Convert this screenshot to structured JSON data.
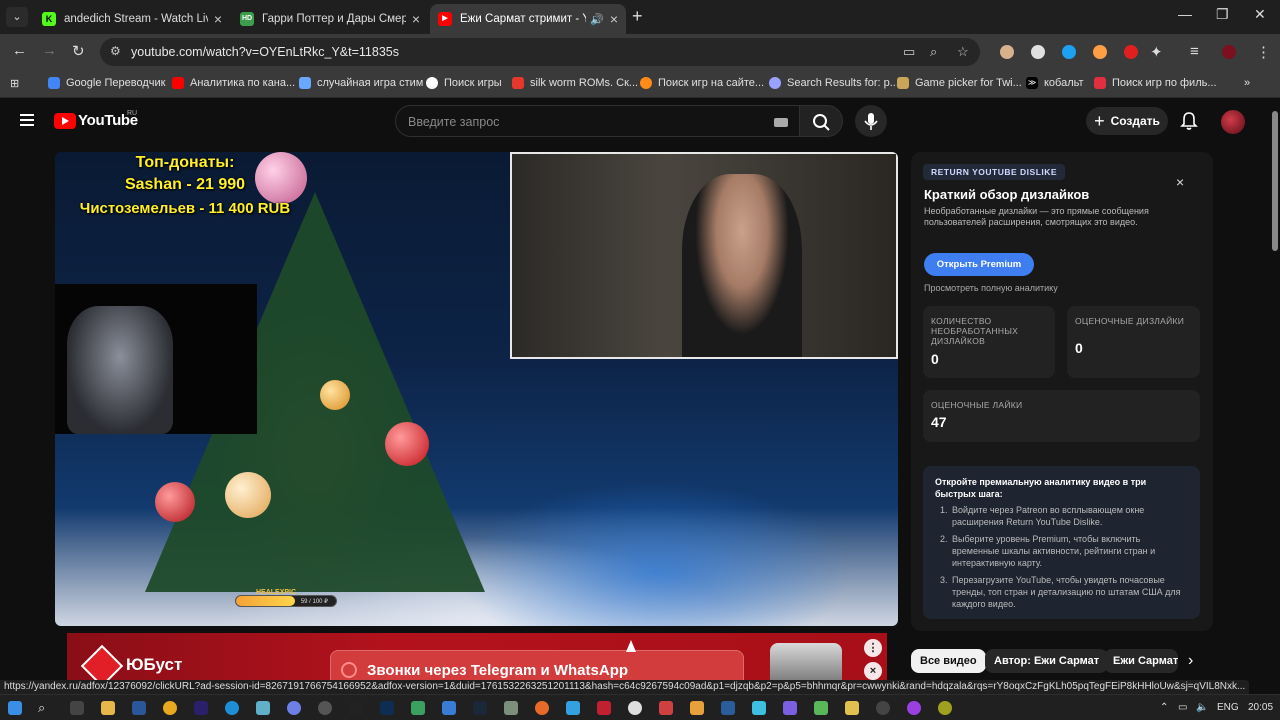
{
  "browser": {
    "tabs": [
      {
        "title": "andedich Stream - Watch Live o",
        "favicon_color": "#53fc18",
        "favicon_letter": "K",
        "active": false
      },
      {
        "title": "Гарри Поттер и Дары Смерти",
        "favicon_color": "#3c9d4a",
        "favicon_letter": "HD",
        "active": false
      },
      {
        "title": "Ежи Сармат стримит - You",
        "favicon_color": "#ff0000",
        "favicon_letter": "▶",
        "active": true
      }
    ],
    "url": "youtube.com/watch?v=OYEnLtRkc_Y&t=11835s",
    "bookmarks": [
      {
        "label": "Google Переводчик",
        "color": "#4285f4"
      },
      {
        "label": "Аналитика по кана...",
        "color": "#ff0000"
      },
      {
        "label": "случайная игра стим",
        "color": "#1b2838"
      },
      {
        "label": "Поиск игры",
        "color": "#ffffff"
      },
      {
        "label": "silk worm ROMs. Ск...",
        "color": "#e8372c"
      },
      {
        "label": "Поиск игр на сайте...",
        "color": "#ff8c1a"
      },
      {
        "label": "Search Results for: p...",
        "color": "#9aa0ff"
      },
      {
        "label": "Game picker for Twi...",
        "color": "#c9a65a"
      },
      {
        "label": "кобальт",
        "color": "#000000"
      },
      {
        "label": "Поиск игр по филь...",
        "color": "#e03040"
      }
    ]
  },
  "youtube": {
    "logo_text": "YouTube",
    "region": "RU",
    "search_placeholder": "Введите запрос",
    "create_label": "Создать"
  },
  "video": {
    "donations_title": "Топ-донаты:",
    "donation_1": "Sashan - 21 990",
    "donation_2": "Чистоземельев - 11 400 RUB",
    "exp_label": "HEALEXPIC",
    "exp_value": "59 / 100 ₽",
    "exp_progress": 0.59
  },
  "ryd": {
    "badge": "RETURN YOUTUBE DISLIKE",
    "close": "×",
    "title": "Краткий обзор дизлайков",
    "description": "Необработанные дизлайки — это прямые сообщения пользователей расширения, смотрящих это видео.",
    "premium_button": "Открыть Premium",
    "full_analytics_link": "Просмотреть полную аналитику",
    "stats": [
      {
        "label": "Количество необработанных дизлайков",
        "value": "0"
      },
      {
        "label": "Оценочные дизлайки",
        "value": "0"
      },
      {
        "label": "Оценочные лайки",
        "value": "47"
      }
    ],
    "promo_title": "Откройте премиальную аналитику видео в три быстрых шага:",
    "promo_steps": [
      "Войдите через Patreon во всплывающем окне расширения Return YouTube Dislike.",
      "Выберите уровень Premium, чтобы включить временные шкалы активности, рейтинги стран и интерактивную карту.",
      "Перезагрузите YouTube, чтобы увидеть почасовые тренды, топ стран и детализацию по штатам США для каждого видео."
    ]
  },
  "chips": [
    "Все видео",
    "Автор: Ежи Сармат",
    "Ежи Сармат"
  ],
  "ad": {
    "brand": "ЮБуст",
    "headline": "Звонки через Telegram и WhatsApp"
  },
  "status_url": "https://yandex.ru/adfox/12376092/clickURL?ad-session-id=8267191766754166952&adfox-version=1&duid=1761532263251201113&hash=c64c9267594c09ad&p1=djzqb&p2=p&p5=bhhmqr&pr=cwwynki&rand=hdqzala&rqs=rY8oqxCzFgKLh05pqTegFEiP8kHHloUw&sj=qVIL8Nxk...",
  "taskbar": {
    "language": "ENG",
    "time": "20:05"
  }
}
